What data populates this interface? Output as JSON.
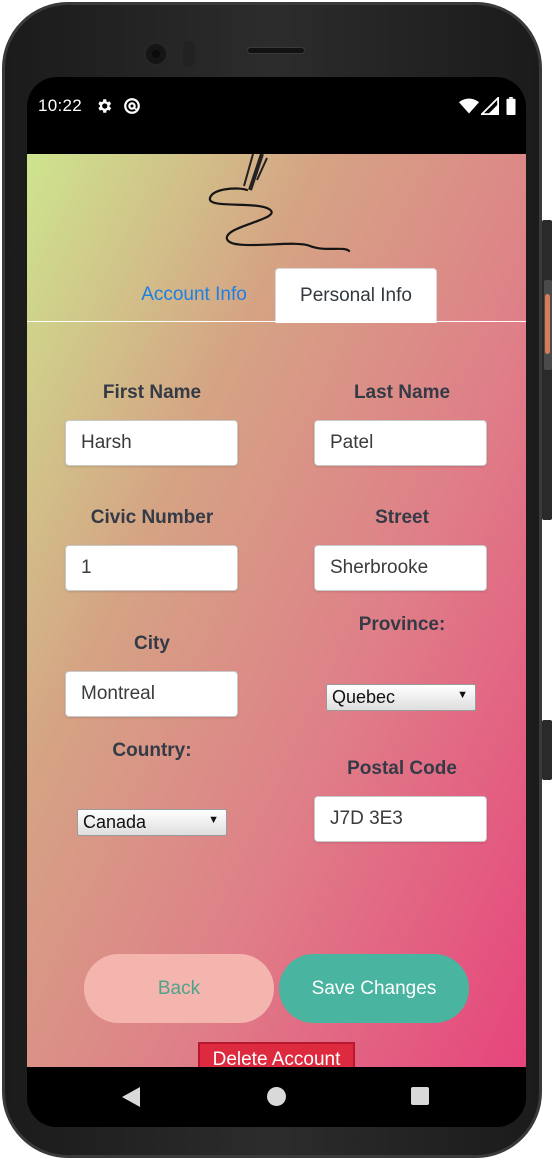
{
  "status_bar": {
    "time": "10:22",
    "icons": [
      "gear-icon",
      "at-icon",
      "wifi-icon",
      "signal-icon",
      "battery-icon"
    ]
  },
  "tabs": [
    {
      "label": "Account Info",
      "active": false
    },
    {
      "label": "Personal Info",
      "active": true
    }
  ],
  "form": {
    "first_name": {
      "label": "First Name",
      "value": "Harsh"
    },
    "last_name": {
      "label": "Last Name",
      "value": "Patel"
    },
    "civic_number": {
      "label": "Civic Number",
      "value": "1"
    },
    "street": {
      "label": "Street",
      "value": "Sherbrooke"
    },
    "city": {
      "label": "City",
      "value": "Montreal"
    },
    "province": {
      "label": "Province:",
      "selected": "Quebec"
    },
    "country": {
      "label": "Country:",
      "selected": "Canada"
    },
    "postal_code": {
      "label": "Postal Code",
      "value": "J7D 3E3"
    }
  },
  "buttons": {
    "back": "Back",
    "save": "Save Changes",
    "delete": "Delete Account"
  },
  "colors": {
    "gradient_start": "#cde58e",
    "gradient_end": "#e6457c",
    "tab_link": "#1b7fe3",
    "back_button": "#f3b5ae",
    "save_button": "#49b4a0",
    "delete_button": "#dd2a3e"
  }
}
